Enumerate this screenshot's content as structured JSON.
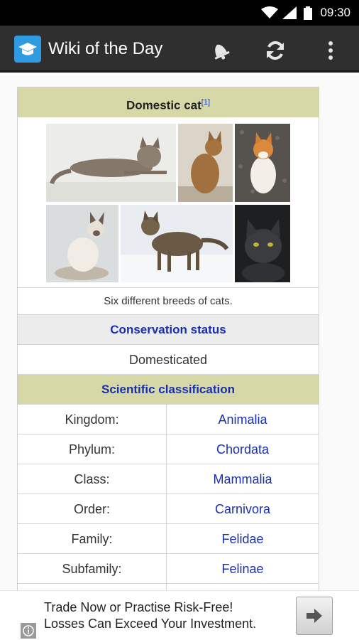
{
  "status_bar": {
    "time": "09:30"
  },
  "app_bar": {
    "title": "Wiki of the Day",
    "actions": [
      "bell-icon",
      "refresh-icon",
      "overflow-menu-icon"
    ]
  },
  "infobox": {
    "title": "Domestic cat",
    "ref": "[1]",
    "images": [
      "tabby-cat-lying-photo",
      "abyssinian-cat-sitting-photo",
      "orange-white-cat-photo",
      "siamese-cat-photo",
      "tabby-cat-in-snow-photo",
      "black-cat-photo"
    ],
    "caption": "Six different breeds of cats.",
    "conservation_header": "Conservation status",
    "conservation_value": "Domesticated",
    "classification_header": "Scientific classification",
    "taxonomy": [
      {
        "label": "Kingdom:",
        "value": "Animalia"
      },
      {
        "label": "Phylum:",
        "value": "Chordata"
      },
      {
        "label": "Class:",
        "value": "Mammalia"
      },
      {
        "label": "Order:",
        "value": "Carnivora"
      },
      {
        "label": "Family:",
        "value": "Felidae"
      },
      {
        "label": "Subfamily:",
        "value": "Felinae"
      }
    ]
  },
  "ad": {
    "line1": "Trade Now or Practise Risk-Free!",
    "line2": "Losses Can Exceed Your Investment."
  }
}
